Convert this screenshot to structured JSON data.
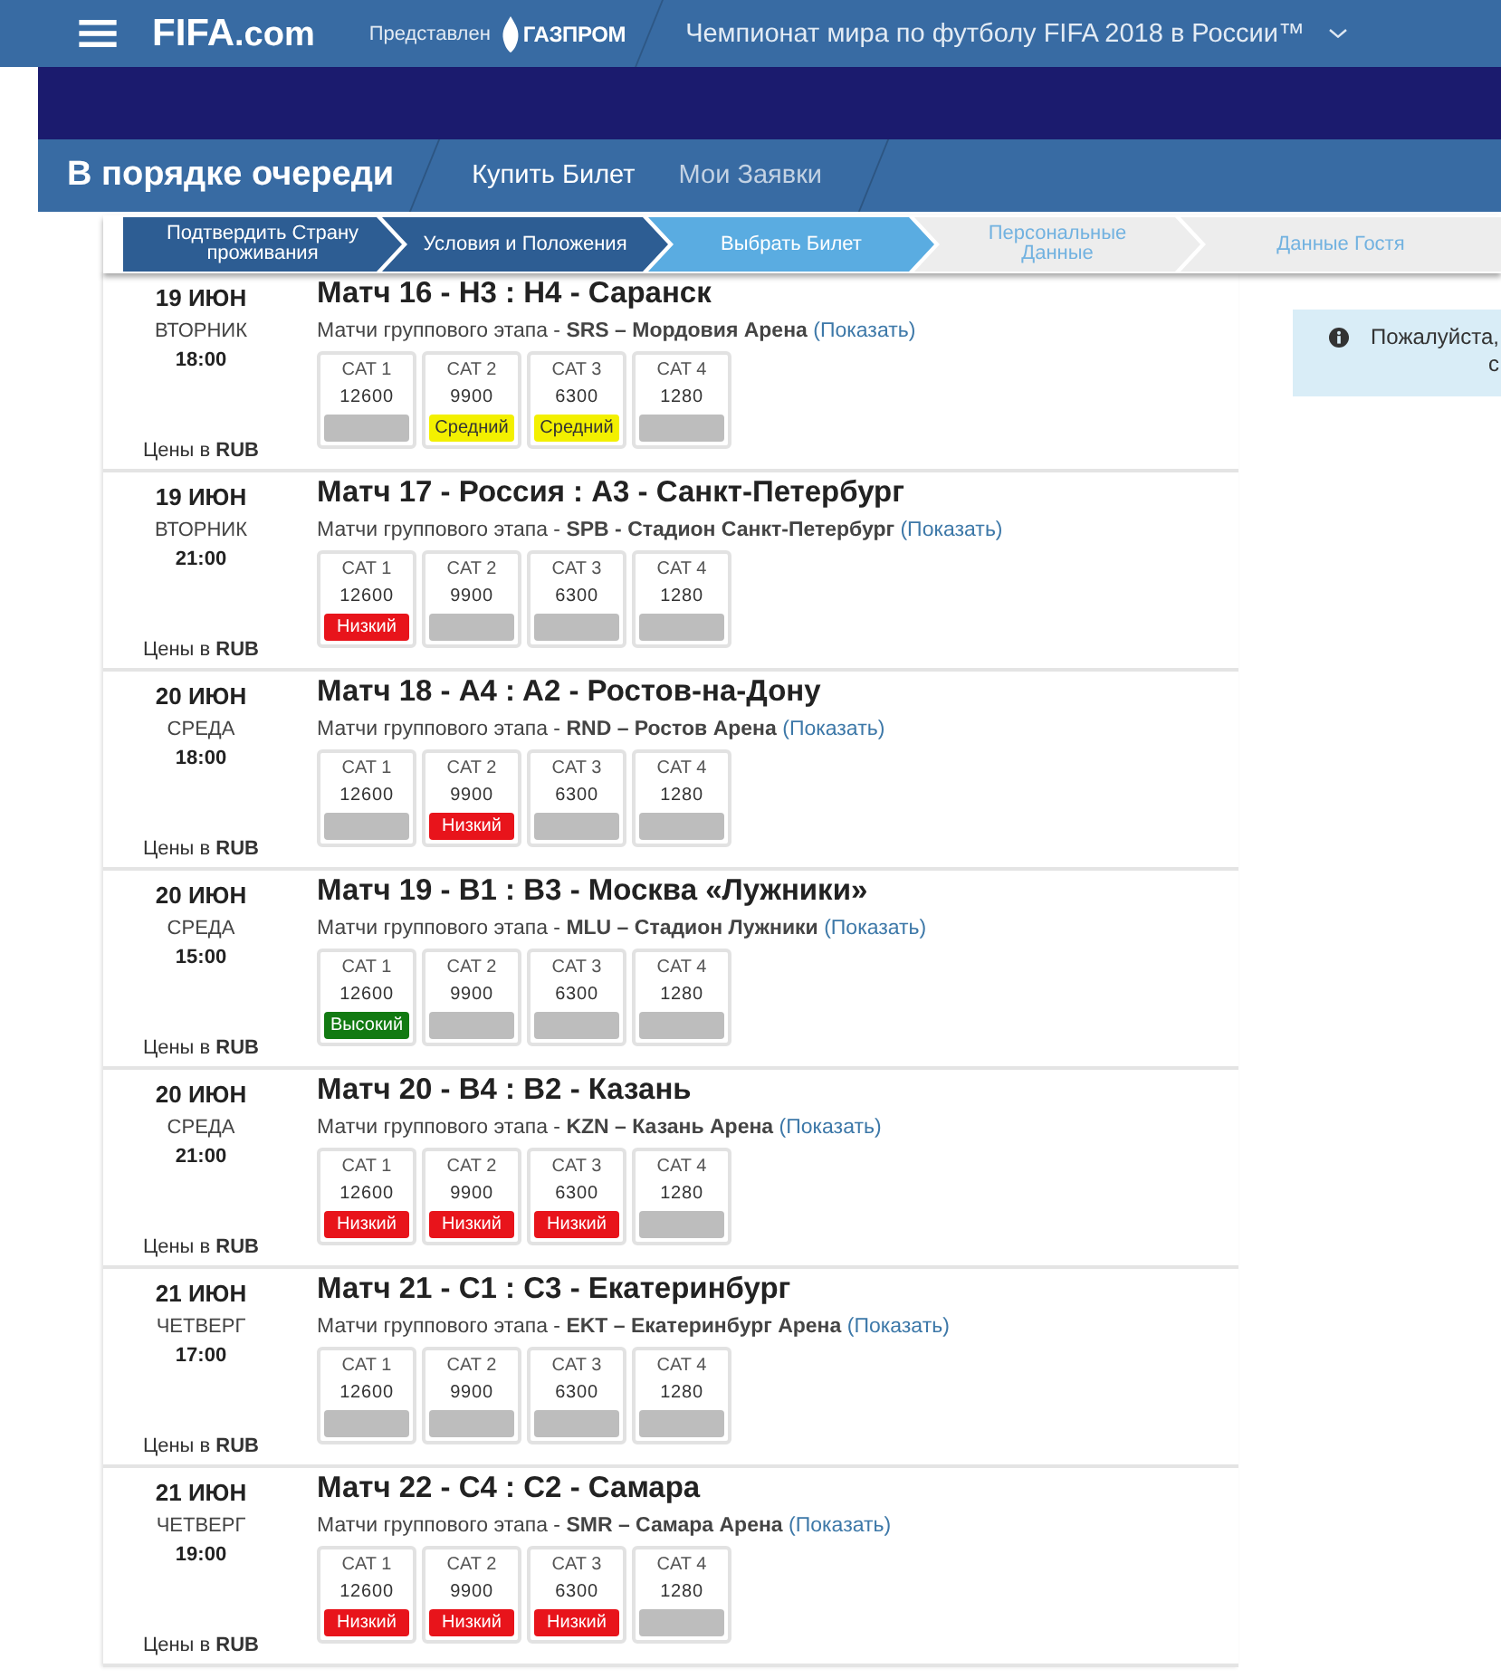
{
  "header": {
    "logo_main": "FIFA",
    "logo_suffix": ".com",
    "sponsor_label": "Представлен",
    "sponsor_logo": "ГАЗПРОМ",
    "title": "Чемпионат мира по футболу FIFA 2018 в России™"
  },
  "queue_bar": {
    "title": "В порядке очереди",
    "tabs": [
      {
        "label": "Купить Билет",
        "selected": true
      },
      {
        "label": "Мои Заявки",
        "selected": false
      }
    ]
  },
  "steps": [
    {
      "label": "Подтвердить Страну проживания",
      "completed": true,
      "selected": false
    },
    {
      "label": "Условия и Положения",
      "completed": true,
      "selected": false
    },
    {
      "label": "Выбрать Билет",
      "completed": false,
      "selected": true
    },
    {
      "label": "Персональные Данные",
      "completed": false,
      "selected": false
    },
    {
      "label": "Данные Гостя",
      "completed": false,
      "selected": false
    }
  ],
  "matches": [
    {
      "date": "19 ИЮН",
      "weekday": "ВТОРНИК",
      "time": "18:00",
      "price_note": "Цены в **RUB**",
      "title": "Матч 16 - H3 : H4 - Саранск",
      "stage": "Матчи группового этапа - **SRS – Мордовия Арена**",
      "link": "(Показать)",
      "categories": [
        {
          "name": "CAT 1",
          "price": "12600",
          "color": "#bdbdbd"
        },
        {
          "name": "CAT 2",
          "price": "9900",
          "color": "#f3f000",
          "label": "Средний"
        },
        {
          "name": "CAT 3",
          "price": "6300",
          "color": "#f3f000",
          "label": "Средний"
        },
        {
          "name": "CAT 4",
          "price": "1280",
          "color": "#bdbdbd"
        }
      ]
    },
    {
      "date": "19 ИЮН",
      "weekday": "ВТОРНИК",
      "time": "21:00",
      "price_note": "Цены в **RUB**",
      "title": "Матч 17 - Россия : A3 - Санкт-Петербург",
      "stage": "Матчи группового этапа - **SPB - Стадион Санкт-Петербург**",
      "link": "(Показать)",
      "categories": [
        {
          "name": "CAT 1",
          "price": "12600",
          "color": "#e8141b",
          "label": "Низкий"
        },
        {
          "name": "CAT 2",
          "price": "9900",
          "color": "#bdbdbd"
        },
        {
          "name": "CAT 3",
          "price": "6300",
          "color": "#bdbdbd"
        },
        {
          "name": "CAT 4",
          "price": "1280",
          "color": "#bdbdbd"
        }
      ]
    },
    {
      "date": "20 ИЮН",
      "weekday": "СРЕДА",
      "time": "18:00",
      "price_note": "Цены в **RUB**",
      "title": "Матч 18 - A4 : A2 - Ростов-на-Дону",
      "stage": "Матчи группового этапа - **RND – Ростов Арена**",
      "link": "(Показать)",
      "categories": [
        {
          "name": "CAT 1",
          "price": "12600",
          "color": "#bdbdbd"
        },
        {
          "name": "CAT 2",
          "price": "9900",
          "color": "#e8141b",
          "label": "Низкий"
        },
        {
          "name": "CAT 3",
          "price": "6300",
          "color": "#bdbdbd"
        },
        {
          "name": "CAT 4",
          "price": "1280",
          "color": "#bdbdbd"
        }
      ]
    },
    {
      "date": "20 ИЮН",
      "weekday": "СРЕДА",
      "time": "15:00",
      "price_note": "Цены в **RUB**",
      "title": "Матч 19 - B1 : B3 - Москва «Лужники»",
      "stage": "Матчи группового этапа - **MLU – Стадион Лужники**",
      "link": "(Показать)",
      "categories": [
        {
          "name": "CAT 1",
          "price": "12600",
          "color": "#127a12",
          "label": "Высокий"
        },
        {
          "name": "CAT 2",
          "price": "9900",
          "color": "#bdbdbd"
        },
        {
          "name": "CAT 3",
          "price": "6300",
          "color": "#bdbdbd"
        },
        {
          "name": "CAT 4",
          "price": "1280",
          "color": "#bdbdbd"
        }
      ]
    },
    {
      "date": "20 ИЮН",
      "weekday": "СРЕДА",
      "time": "21:00",
      "price_note": "Цены в **RUB**",
      "title": "Матч 20 - B4 : B2 - Казань",
      "stage": "Матчи группового этапа - **KZN – Казань Арена**",
      "link": "(Показать)",
      "categories": [
        {
          "name": "CAT 1",
          "price": "12600",
          "color": "#e8141b",
          "label": "Низкий"
        },
        {
          "name": "CAT 2",
          "price": "9900",
          "color": "#e8141b",
          "label": "Низкий"
        },
        {
          "name": "CAT 3",
          "price": "6300",
          "color": "#e8141b",
          "label": "Низкий"
        },
        {
          "name": "CAT 4",
          "price": "1280",
          "color": "#bdbdbd"
        }
      ]
    },
    {
      "date": "21 ИЮН",
      "weekday": "ЧЕТВЕРГ",
      "time": "17:00",
      "price_note": "Цены в **RUB**",
      "title": "Матч 21 - C1 : C3 - Екатеринбург",
      "stage": "Матчи группового этапа - **EKT – Екатеринбург Арена**",
      "link": "(Показать)",
      "categories": [
        {
          "name": "CAT 1",
          "price": "12600",
          "color": "#bdbdbd"
        },
        {
          "name": "CAT 2",
          "price": "9900",
          "color": "#bdbdbd"
        },
        {
          "name": "CAT 3",
          "price": "6300",
          "color": "#bdbdbd"
        },
        {
          "name": "CAT 4",
          "price": "1280",
          "color": "#bdbdbd"
        }
      ]
    },
    {
      "date": "21 ИЮН",
      "weekday": "ЧЕТВЕРГ",
      "time": "19:00",
      "price_note": "Цены в **RUB**",
      "title": "Матч 22 - C4 : C2 - Самара",
      "stage": "Матчи группового этапа - **SMR – Самара Арена**",
      "link": "(Показать)",
      "categories": [
        {
          "name": "CAT 1",
          "price": "12600",
          "color": "#e8141b",
          "label": "Низкий"
        },
        {
          "name": "CAT 2",
          "price": "9900",
          "color": "#e8141b",
          "label": "Низкий"
        },
        {
          "name": "CAT 3",
          "price": "6300",
          "color": "#e8141b",
          "label": "Низкий"
        },
        {
          "name": "CAT 4",
          "price": "1280",
          "color": "#bdbdbd"
        }
      ]
    }
  ],
  "notice": {
    "text": "Пожалуйста, с"
  }
}
